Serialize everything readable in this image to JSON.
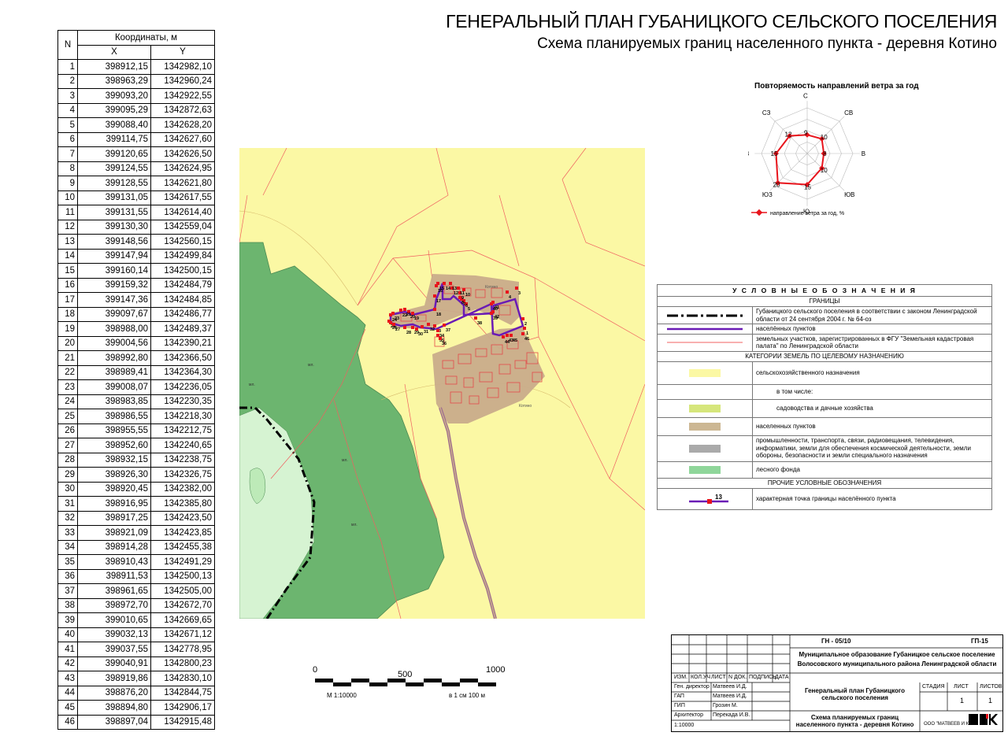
{
  "titles": {
    "main": "ГЕНЕРАЛЬНЫЙ ПЛАН ГУБАНИЦКОГО СЕЛЬСКОГО ПОСЕЛЕНИЯ",
    "sub": "Схема планируемых границ населенного пункта - деревня Котино"
  },
  "table": {
    "col_n": "N",
    "col_coords": "Координаты, м",
    "col_x": "X",
    "col_y": "Y",
    "rows": [
      [
        "1",
        "398912,15",
        "1342982,10"
      ],
      [
        "2",
        "398963,29",
        "1342960,24"
      ],
      [
        "3",
        "399093,20",
        "1342922,55"
      ],
      [
        "4",
        "399095,29",
        "1342872,63"
      ],
      [
        "5",
        "399088,40",
        "1342628,20"
      ],
      [
        "6",
        "399114,75",
        "1342627,60"
      ],
      [
        "7",
        "399120,65",
        "1342626,50"
      ],
      [
        "8",
        "399124,55",
        "1342624,95"
      ],
      [
        "9",
        "399128,55",
        "1342621,80"
      ],
      [
        "10",
        "399131,05",
        "1342617,55"
      ],
      [
        "11",
        "399131,55",
        "1342614,40"
      ],
      [
        "12",
        "399130,30",
        "1342559,04"
      ],
      [
        "13",
        "399148,56",
        "1342560,15"
      ],
      [
        "14",
        "399147,94",
        "1342499,84"
      ],
      [
        "15",
        "399160,14",
        "1342500,15"
      ],
      [
        "16",
        "399159,32",
        "1342484,79"
      ],
      [
        "17",
        "399147,36",
        "1342484,85"
      ],
      [
        "18",
        "399097,67",
        "1342486,77"
      ],
      [
        "19",
        "398988,00",
        "1342489,37"
      ],
      [
        "20",
        "399004,56",
        "1342390,21"
      ],
      [
        "21",
        "398992,80",
        "1342366,50"
      ],
      [
        "22",
        "398989,41",
        "1342364,30"
      ],
      [
        "23",
        "399008,07",
        "1342236,05"
      ],
      [
        "24",
        "398983,85",
        "1342230,35"
      ],
      [
        "25",
        "398986,55",
        "1342218,30"
      ],
      [
        "26",
        "398955,55",
        "1342212,75"
      ],
      [
        "27",
        "398952,60",
        "1342240,65"
      ],
      [
        "28",
        "398932,15",
        "1342238,75"
      ],
      [
        "29",
        "398926,30",
        "1342326,75"
      ],
      [
        "30",
        "398920,45",
        "1342382,00"
      ],
      [
        "31",
        "398916,95",
        "1342385,80"
      ],
      [
        "32",
        "398917,25",
        "1342423,50"
      ],
      [
        "33",
        "398921,09",
        "1342423,85"
      ],
      [
        "34",
        "398914,28",
        "1342455,38"
      ],
      [
        "35",
        "398910,43",
        "1342491,29"
      ],
      [
        "36",
        "398911,53",
        "1342500,13"
      ],
      [
        "37",
        "398961,65",
        "1342505,00"
      ],
      [
        "38",
        "398972,70",
        "1342672,70"
      ],
      [
        "39",
        "399010,65",
        "1342669,65"
      ],
      [
        "40",
        "399032,13",
        "1342671,12"
      ],
      [
        "41",
        "399037,55",
        "1342778,95"
      ],
      [
        "42",
        "399040,91",
        "1342800,23"
      ],
      [
        "43",
        "398919,86",
        "1342830,10"
      ],
      [
        "44",
        "398876,20",
        "1342844,75"
      ],
      [
        "45",
        "398894,80",
        "1342906,17"
      ],
      [
        "46",
        "398897,04",
        "1342915,48"
      ]
    ]
  },
  "wind_rose": {
    "title": "Повторяемость направлений ветра за год",
    "directions": [
      "С",
      "СВ",
      "В",
      "ЮВ",
      "Ю",
      "ЮЗ",
      "З",
      "СЗ"
    ],
    "values": [
      9,
      10,
      8,
      10,
      15,
      20,
      15,
      12
    ],
    "legend": "направление ветра за год, %",
    "color": "#e8141c"
  },
  "legend": {
    "header": "У С Л О В Н Ы Е   О Б О З Н А Ч Е Н И Я",
    "sec_bounds": "ГРАНИЦЫ",
    "bound_settlement": "Губаницкого сельского поселения в соответствии с законом Ленинградской области от 24 сентября 2004 г. № 64-оз",
    "bound_localities": "населённых пунктов",
    "bound_parcels": "земельных участков, зарегистрированных в ФГУ \"Земельная кадастровая палата\" по Ленинградской области",
    "sec_categories": "КАТЕГОРИИ ЗЕМЕЛЬ ПО ЦЕЛЕВОМУ НАЗНАЧЕНИЮ",
    "cat_agri": "сельскохозяйственного назначения",
    "cat_incl": "в том числе:",
    "cat_garden": "садоводства и дачные хозяйства",
    "cat_localities": "населенных пунктов",
    "cat_industry": "промышленности, транспорта, связи, радиовещания, телевидения, информатики, земли для обеспечения космической деятельности, земли обороны, безопасности и земли специального назначения",
    "cat_forest": "лесного фонда",
    "sec_other": "ПРОЧИЕ УСЛОВНЫЕ ОБОЗНАЧЕНИЯ",
    "point_label": "13",
    "point_text": "характерная точка границы населённого пункта",
    "colors": {
      "agri": "#fbf8a4",
      "garden": "#d6e67c",
      "localities": "#ccb793",
      "industry": "#aaaaaa",
      "forest": "#8fd69a",
      "boundary": "#6a1bb5",
      "parcel": "#f06060"
    }
  },
  "map": {
    "labels": {
      "kotino_top": "Котино",
      "kotino_bottom": "Котино",
      "forest1": "мл.",
      "forest2": "мл.",
      "forest3": "мл.",
      "forest4": "мл."
    },
    "colors": {
      "agri": "#fbf8a4",
      "forest": "#6cb56f",
      "light_forest": "#d6f3d2",
      "locality": "#c9ac8b",
      "road": "#9d6b8e"
    }
  },
  "scale": {
    "ticks": [
      "0",
      "500",
      "1000"
    ],
    "ratio": "М 1:10000",
    "per_cm": "в 1 см 100 м"
  },
  "stamp": {
    "code": "ГН - 05/10",
    "sheet_code": "ГП-15",
    "org1": "Муниципальное образование Губаницкое сельское поселение",
    "org2": "Волосовского  муниципального района Ленинградской области",
    "cols": [
      "ИЗМ.",
      "КОЛ.УЧ",
      "ЛИСТ",
      "N ДОК.",
      "ПОДПИСЬ",
      "ДАТА"
    ],
    "people": [
      [
        "Ген. директор",
        "Матвеев И.Д."
      ],
      [
        "ГАП",
        "Матвеев И.Д."
      ],
      [
        "ГИП",
        "Грозин М."
      ],
      [
        "Архитектор",
        "Перекада И.В."
      ]
    ],
    "project": "Генеральный план Губаницкого сельского поселения",
    "stage_h": "СТАДИЯ",
    "sheet_h": "ЛИСТ",
    "sheets_h": "ЛИСТОВ",
    "sheet": "1",
    "sheets": "1",
    "scheme": "Схема планируемых границ населенного пункта - деревня Котино",
    "scale": "1:10000",
    "company": "ООО \"МАТВЕЕВ И К.\""
  }
}
